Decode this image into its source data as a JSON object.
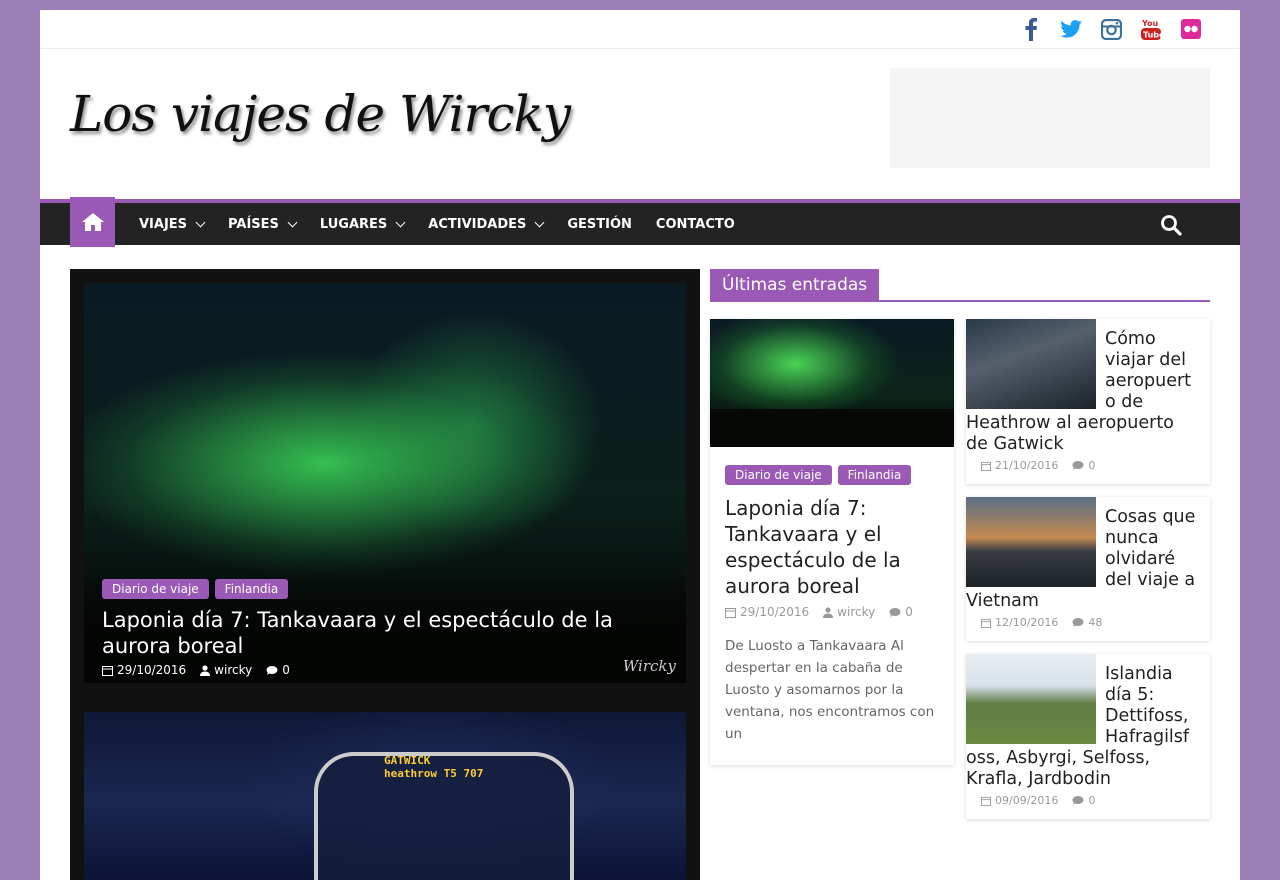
{
  "site": {
    "logo_text": "Los viajes de Wircky",
    "social": [
      "facebook-icon",
      "twitter-icon",
      "instagram-icon",
      "youtube-icon",
      "flickr-icon"
    ]
  },
  "nav": {
    "items": [
      {
        "label": "VIAJES",
        "has_dropdown": true
      },
      {
        "label": "PAÍSES",
        "has_dropdown": true
      },
      {
        "label": "LUGARES",
        "has_dropdown": true
      },
      {
        "label": "ACTIVIDADES",
        "has_dropdown": true
      },
      {
        "label": "GESTIÓN",
        "has_dropdown": false
      },
      {
        "label": "CONTACTO",
        "has_dropdown": false
      }
    ]
  },
  "slider": {
    "categories": [
      "Diario de viaje",
      "Finlandia"
    ],
    "title": "Laponia día 7: Tankavaara y el espectáculo de la aurora boreal",
    "date": "29/10/2016",
    "author": "wircky",
    "comments": "0",
    "watermark": "Wircky",
    "slide2_sign_line1": "GATWICK",
    "slide2_sign_line2": "heathrow T5   707"
  },
  "latest": {
    "heading": "Últimas entradas",
    "featured": {
      "categories": [
        "Diario de viaje",
        "Finlandia"
      ],
      "title": "Laponia día 7: Tankavaara y el espectáculo de la aurora boreal",
      "date": "29/10/2016",
      "author": "wircky",
      "comments": "0",
      "excerpt": "De Luosto a Tankavaara Al despertar en la cabaña de Luosto y asomarnos por la ventana, nos encontramos con un"
    },
    "posts": [
      {
        "lead": "Cómo viajar del aeropuert o de",
        "tail": "Heathrow al aeropuerto de Gatwick",
        "date": "21/10/2016",
        "comments": "0"
      },
      {
        "lead": "Cosas que nunca olvidaré del viaje a",
        "tail": "Vietnam",
        "date": "12/10/2016",
        "comments": "48"
      },
      {
        "lead": "Islandia día 5: Dettifoss, Hafragilsf oss, Asbyrgi, Selfoss,",
        "tail": "Krafla, Jardbodin",
        "date": "09/09/2016",
        "comments": "0"
      }
    ]
  },
  "colors": {
    "accent": "#9b59b6",
    "page_bg": "#9c7fb6",
    "nav_bg": "#232323"
  }
}
